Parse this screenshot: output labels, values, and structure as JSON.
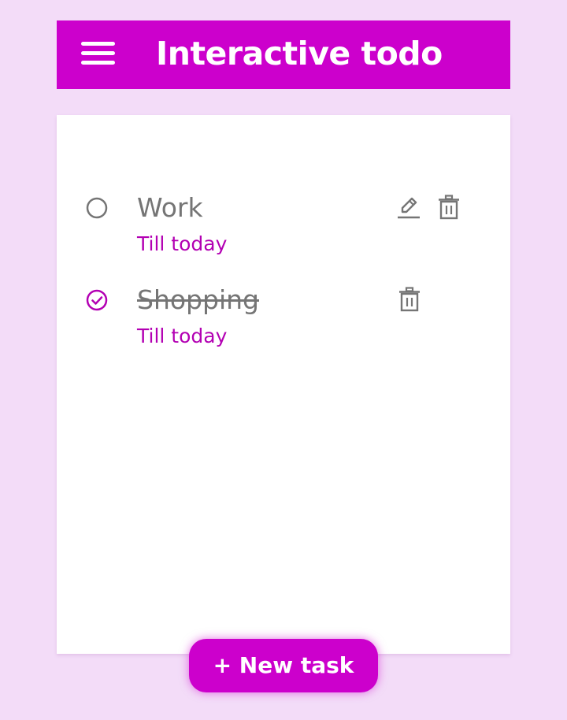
{
  "app": {
    "title": "Interactive todo",
    "accent_color": "#cc00cc",
    "background_color": "#f3dcf8"
  },
  "header": {
    "menu_icon": "hamburger-menu-icon"
  },
  "tasks": [
    {
      "name": "Work",
      "due": "Till today",
      "completed": false,
      "status_icon": "empty-circle-icon",
      "actions": [
        "pencil-icon",
        "trash-icon"
      ]
    },
    {
      "name": "Shopping",
      "due": "Till today",
      "completed": true,
      "status_icon": "check-circle-icon",
      "actions": [
        "trash-icon"
      ]
    }
  ],
  "new_task_button": {
    "label": "+ New task"
  }
}
